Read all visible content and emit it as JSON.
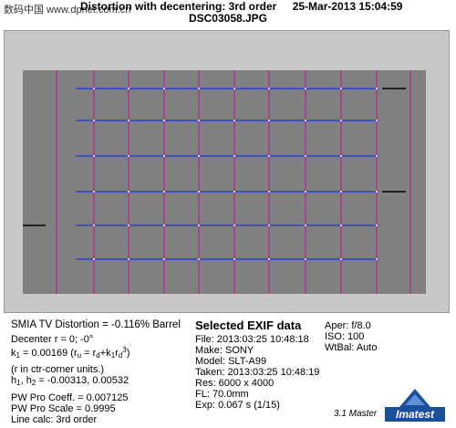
{
  "header": {
    "title": "Distortion with decentering:  3rd order",
    "date": "25-Mar-2013 15:04:59",
    "filename": "DSC03058.JPG",
    "watermark": "数码中国 www.dpnet.com.cn"
  },
  "left_panel": {
    "smia": "SMIA TV Distortion = -0.116% Barrel",
    "decenter": "Decenter r = 0;  -0°",
    "k1_prefix": "k",
    "k1_value": " = 0.00169  (r",
    "k1_formula_a": "u",
    "k1_formula_b": " = r",
    "k1_formula_c": "d",
    "k1_formula_d": "+k",
    "k1_formula_e": "1",
    "k1_formula_f": "r",
    "k1_formula_g": "d",
    "k1_formula_h": "3",
    "k1_formula_i": ")",
    "units_note": "(r in ctr-corner units.)",
    "h_label": "h",
    "h_values": ", h",
    "h_values2": " = -0.00313, 0.00532",
    "pw_coeff": "PW Pro Coeff. = 0.007125",
    "pw_scale": "PW Pro Scale = 0.9995",
    "line_calc": "Line calc: 3rd order"
  },
  "exif": {
    "title": "Selected EXIF data",
    "file": "File:  2013:03:25 10:48:18",
    "make": "Make:  SONY",
    "model": "Model:  SLT-A99",
    "taken": "Taken: 2013:03:25 10:48:19",
    "res": "Res:    6000 x 4000",
    "fl": "FL:  70.0mm",
    "exp": "Exp:  0.067 s  (1/15)"
  },
  "right_panel": {
    "aper": "Aper:  f/8.0",
    "iso": "ISO:    100",
    "wtbal": "WtBal:  Auto",
    "version": "3.1  Master"
  },
  "logo": {
    "text": "Imatest",
    "color": "#1a4f9c"
  },
  "colors": {
    "vertical_lines": "#b0309a",
    "horizontal_lines": "#2e3fd8",
    "chart_bg": "#808080",
    "plot_bg": "#c8c8c8"
  }
}
